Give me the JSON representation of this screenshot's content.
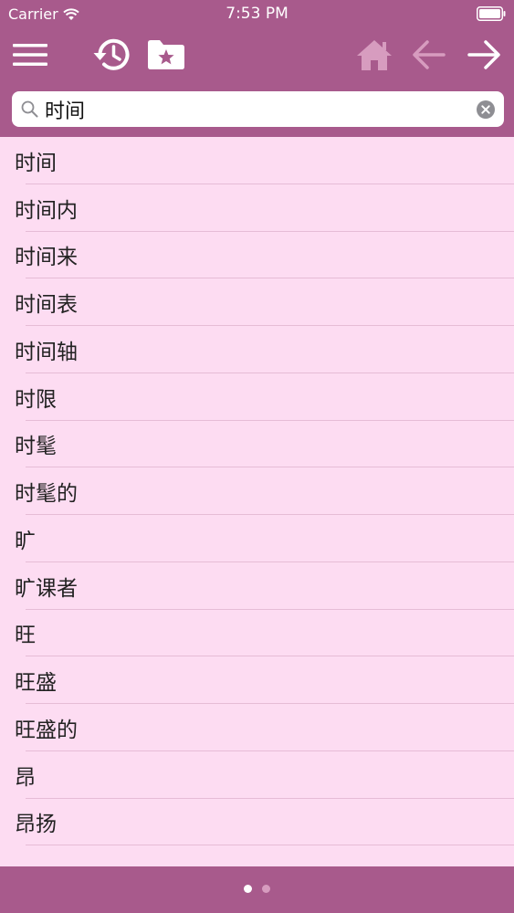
{
  "status_bar": {
    "carrier": "Carrier",
    "time": "7:53 PM"
  },
  "toolbar": {
    "icons": [
      "menu-icon",
      "history-icon",
      "favorites-folder-icon",
      "home-icon",
      "back-arrow-icon",
      "forward-arrow-icon"
    ]
  },
  "search": {
    "value": "时间",
    "placeholder": ""
  },
  "results": [
    {
      "label": "时间"
    },
    {
      "label": "时间内"
    },
    {
      "label": "时间来"
    },
    {
      "label": "时间表"
    },
    {
      "label": "时间轴"
    },
    {
      "label": "时限"
    },
    {
      "label": "时髦"
    },
    {
      "label": "时髦的"
    },
    {
      "label": "旷"
    },
    {
      "label": "旷课者"
    },
    {
      "label": "旺"
    },
    {
      "label": "旺盛"
    },
    {
      "label": "旺盛的"
    },
    {
      "label": "昂"
    },
    {
      "label": "昂扬"
    }
  ],
  "pager": {
    "pages": 2,
    "current": 1
  },
  "colors": {
    "bar": "#a85a8c",
    "list_bg": "#fddcf2",
    "separator": "#e6bcd6",
    "icon_dim": "#d79cbf"
  }
}
